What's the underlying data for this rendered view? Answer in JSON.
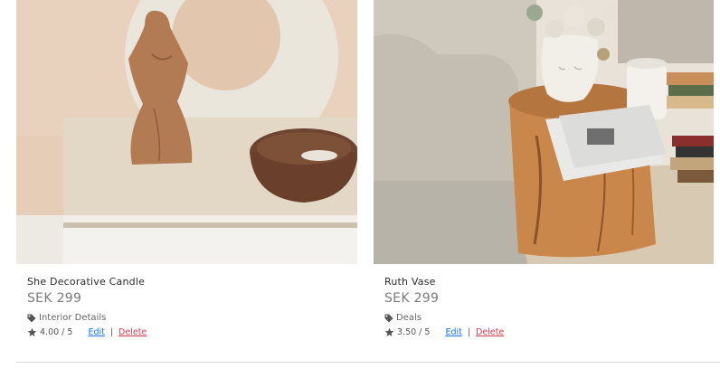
{
  "products": [
    {
      "title": "She Decorative Candle",
      "price": "SEK 299",
      "category": "Interior Details",
      "category_icon": "tag-icon",
      "rating_icon": "star-icon",
      "rating": "4.00 / 5",
      "edit_label": "Edit",
      "separator": "|",
      "delete_label": "Delete"
    },
    {
      "title": "Ruth Vase",
      "price": "SEK 299",
      "category": "Deals",
      "category_icon": "tag-icon",
      "rating_icon": "star-icon",
      "rating": "3.50 / 5",
      "edit_label": "Edit",
      "separator": "|",
      "delete_label": "Delete"
    }
  ],
  "colors": {
    "edit_link": "#1a73e8",
    "delete_link": "#d33b4d"
  }
}
